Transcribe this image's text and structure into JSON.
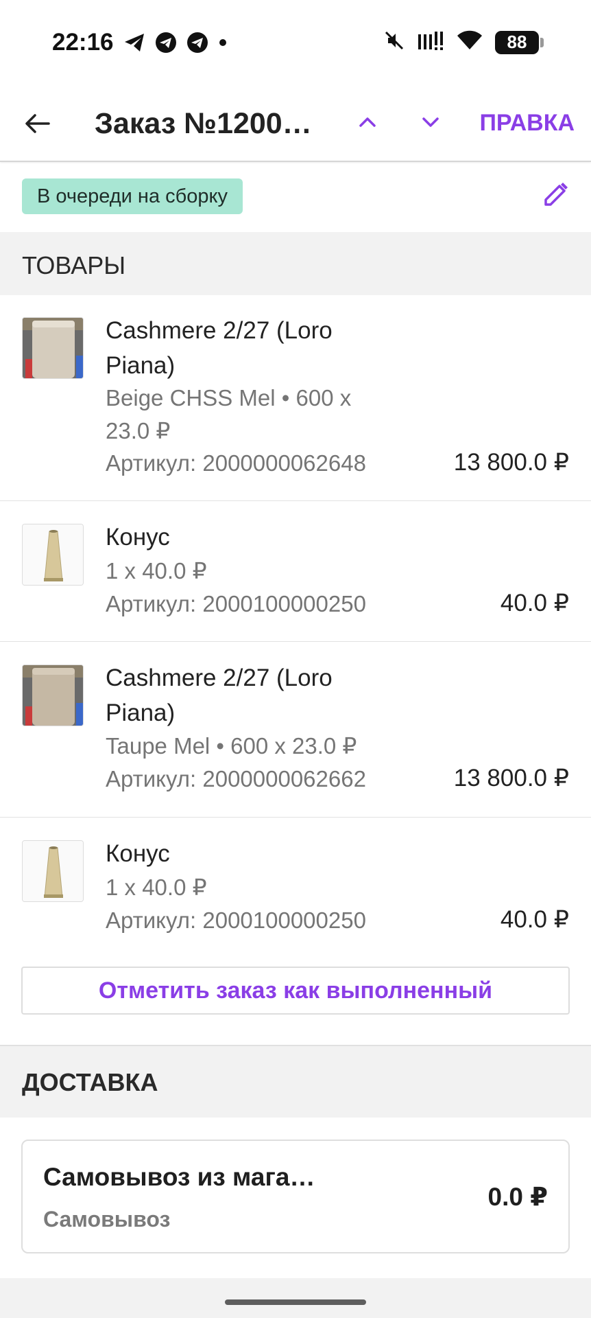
{
  "status_bar": {
    "time": "22:16",
    "notification_icons": [
      "telegram-plane-icon",
      "telegram-circle-icon",
      "telegram-circle-icon",
      "dot-icon"
    ],
    "right_icons": [
      "mute-icon",
      "signal-icon",
      "wifi-icon"
    ],
    "battery": "88"
  },
  "app_bar": {
    "title": "Заказ №1200…",
    "action_label": "ПРАВКА",
    "accent_color": "#8a3ee6"
  },
  "order": {
    "status": "В очереди на сборку",
    "status_color": "#a8e6d3"
  },
  "goods": {
    "header": "ТОВАРЫ",
    "items": [
      {
        "name_line1": "Cashmere 2/27 (Loro",
        "name_line2": "Piana)",
        "detail_line1": "Beige CHSS Mel • 600 x",
        "detail_line2": "23.0 ₽",
        "sku": "Артикул: 2000000062648",
        "price": "13 800.0 ₽",
        "thumbnail": "yarn-cone-beige-image"
      },
      {
        "name_line1": "Конус",
        "detail_line1": "1 x 40.0 ₽",
        "sku": "Артикул: 2000100000250",
        "price": "40.0 ₽",
        "thumbnail": "paper-cone-image"
      },
      {
        "name_line1": "Cashmere 2/27 (Loro",
        "name_line2": "Piana)",
        "detail_line1": "Taupe Mel • 600 x 23.0 ₽",
        "sku": "Артикул: 2000000062662",
        "price": "13 800.0 ₽",
        "thumbnail": "yarn-cone-taupe-image"
      },
      {
        "name_line1": "Конус",
        "detail_line1": "1 x 40.0 ₽",
        "sku": "Артикул: 2000100000250",
        "price": "40.0 ₽",
        "thumbnail": "paper-cone-image"
      }
    ],
    "complete_button": "Отметить заказ как выполненный"
  },
  "delivery": {
    "header": "ДОСТАВКА",
    "title": "Самовывоз из мага…",
    "subtitle": "Самовывоз",
    "price": "0.0 ₽"
  }
}
